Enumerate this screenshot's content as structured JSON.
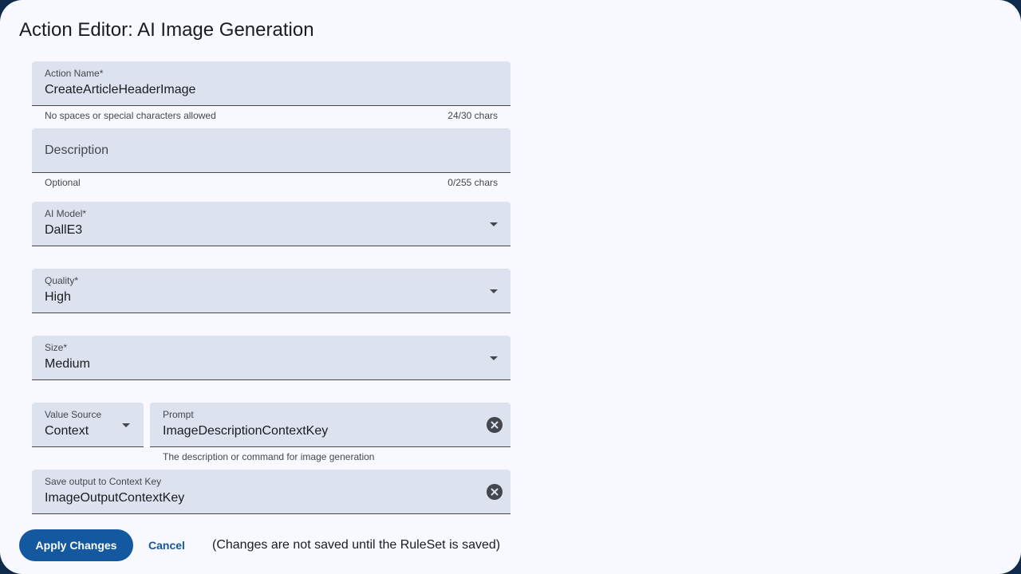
{
  "dialog": {
    "title": "Action Editor: AI Image Generation"
  },
  "fields": {
    "action_name": {
      "label": "Action Name*",
      "value": "CreateArticleHeaderImage",
      "helper": "No spaces or special characters allowed",
      "counter": "24/30 chars"
    },
    "description": {
      "placeholder": "Description",
      "value": "",
      "helper": "Optional",
      "counter": "0/255 chars"
    },
    "ai_model": {
      "label": "AI Model*",
      "value": "DallE3"
    },
    "quality": {
      "label": "Quality*",
      "value": "High"
    },
    "size": {
      "label": "Size*",
      "value": "Medium"
    },
    "value_source": {
      "label": "Value Source",
      "value": "Context"
    },
    "prompt": {
      "label": "Prompt",
      "value": "ImageDescriptionContextKey",
      "helper": "The description or command for image generation"
    },
    "save_output": {
      "label": "Save output to Context Key",
      "value": "ImageOutputContextKey"
    }
  },
  "actions": {
    "apply_label": "Apply Changes",
    "cancel_label": "Cancel",
    "note": "(Changes are not saved until the RuleSet is saved)"
  },
  "icons": {
    "dropdown": "arrow-drop-down-icon",
    "clear": "clear-circle-icon"
  },
  "colors": {
    "primary": "#1458a0",
    "surface": "#f7f9fe",
    "field_fill": "#dce2ee"
  }
}
